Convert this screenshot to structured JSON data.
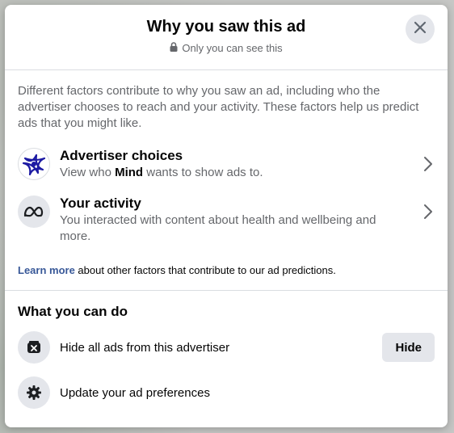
{
  "dialog": {
    "title": "Why you saw this ad",
    "subtitle": "Only you can see this"
  },
  "factors": {
    "intro": "Different factors contribute to why you saw an ad, including who the advertiser chooses to reach and your activity. These factors help us predict ads that you might like.",
    "advertiser": {
      "title": "Advertiser choices",
      "desc_prefix": "View who ",
      "advertiser_name": "Mind",
      "desc_suffix": " wants to show ads to."
    },
    "activity": {
      "title": "Your activity",
      "desc": "You interacted with content about health and wellbeing and more."
    },
    "learn_more": {
      "link": "Learn more",
      "text": " about other factors that contribute to our ad predictions."
    }
  },
  "actions": {
    "title": "What you can do",
    "hide_all": {
      "label": "Hide all ads from this advertiser",
      "button": "Hide"
    },
    "preferences": {
      "label": "Update your ad preferences"
    }
  },
  "icons": {
    "close": "close-icon",
    "lock": "lock-icon",
    "advertiser_logo": "mind-logo-icon",
    "meta": "meta-logo-icon",
    "chevron": "chevron-right-icon",
    "hide_ads": "hide-ads-icon",
    "gear": "gear-icon"
  },
  "colors": {
    "link": "#385898",
    "mind_brand": "#1c1aa3"
  }
}
